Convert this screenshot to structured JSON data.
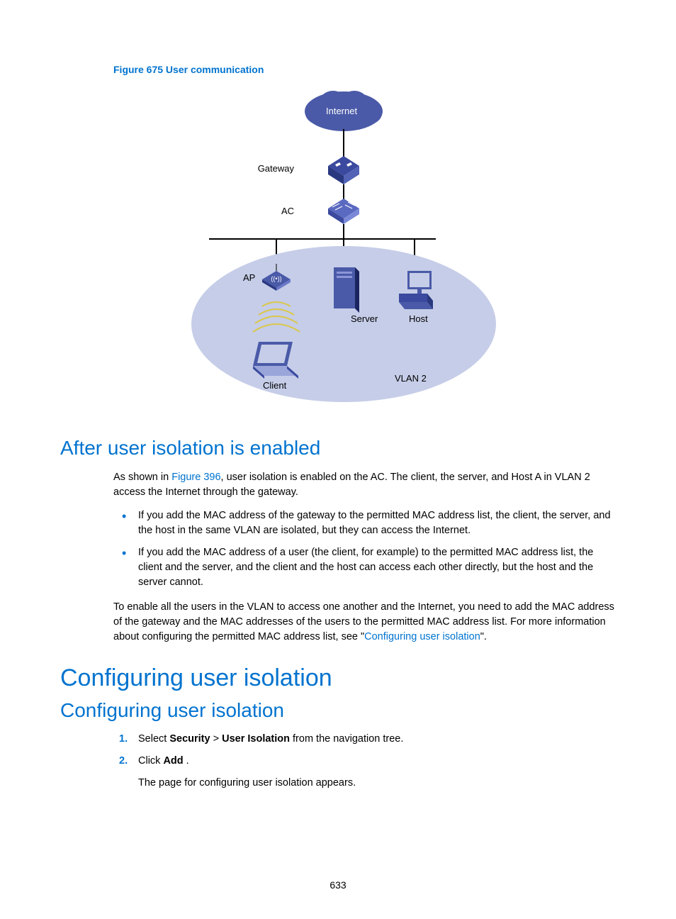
{
  "figure": {
    "caption": "Figure 675 User communication",
    "labels": {
      "internet": "Internet",
      "gateway": "Gateway",
      "ac": "AC",
      "ap": "AP",
      "server": "Server",
      "host": "Host",
      "client": "Client",
      "vlan": "VLAN 2"
    }
  },
  "section1": {
    "heading": "After user isolation is enabled",
    "p1_pre": "As shown in ",
    "p1_link": "Figure 396",
    "p1_post": ", user isolation is enabled on the AC. The client, the server, and Host A in VLAN 2 access the Internet through the gateway.",
    "bullets": [
      "If you add the MAC address of the gateway to the permitted MAC address list, the client, the server, and the host in the same VLAN are isolated, but they can access the Internet.",
      "If you add the MAC address of a user (the client, for example) to the permitted MAC address list, the client and the server, and the client and the host can access each other directly, but the host and the server cannot."
    ],
    "p2_pre": "To enable all the users in the VLAN to access one another and the Internet, you need to add the MAC address of the gateway and the MAC addresses of the users to the permitted MAC address list. For more information about configuring the permitted MAC address list, see \"",
    "p2_link": "Configuring user isolation",
    "p2_post": "\"."
  },
  "section2": {
    "h1": "Configuring user isolation",
    "h2": "Configuring user isolation",
    "steps": {
      "s1_pre": "Select ",
      "s1_b1": "Security",
      "s1_mid": " > ",
      "s1_b2": "User Isolation",
      "s1_post": " from the navigation tree.",
      "s2_pre": "Click ",
      "s2_b": "Add",
      "s2_post": " ."
    },
    "sub": "The page for configuring user isolation appears."
  },
  "pagenum": "633"
}
